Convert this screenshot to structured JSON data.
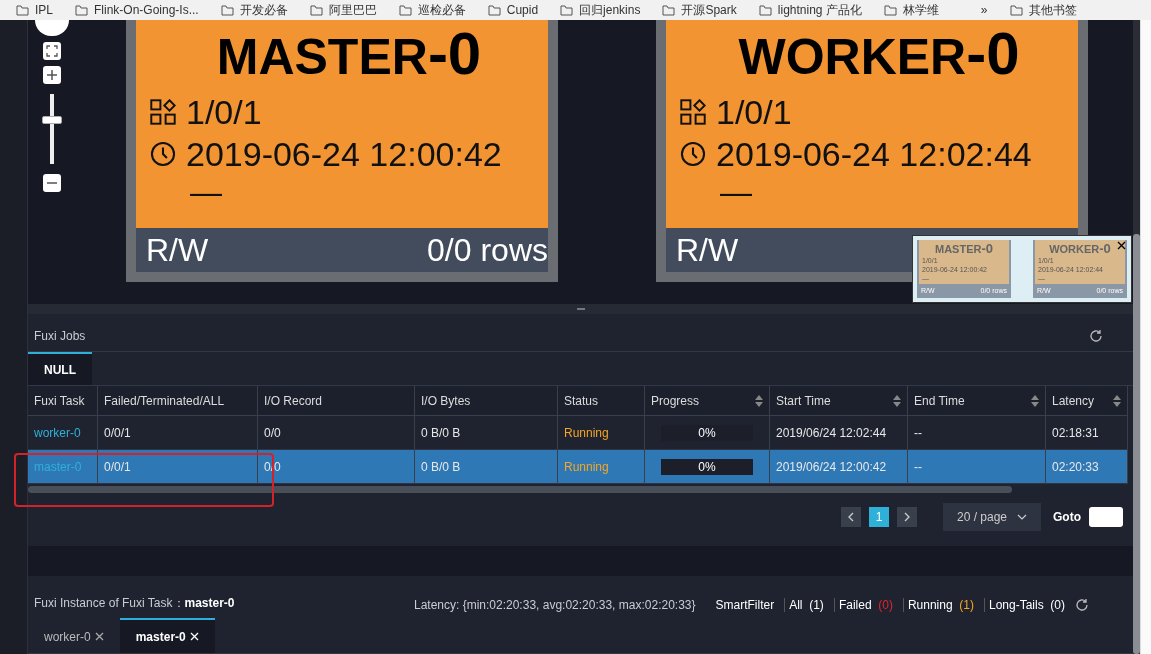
{
  "bookmarks": [
    {
      "label": "IPL"
    },
    {
      "label": "Flink-On-Going-Is..."
    },
    {
      "label": "开发必备"
    },
    {
      "label": "阿里巴巴"
    },
    {
      "label": "巡检必备"
    },
    {
      "label": "Cupid"
    },
    {
      "label": "回归jenkins"
    },
    {
      "label": "开源Spark"
    },
    {
      "label": "lightning 产品化"
    },
    {
      "label": "林学维"
    }
  ],
  "bookmarks_more": "»",
  "other_bookmarks": "其他书签",
  "zoom": {
    "level": 0.63
  },
  "nodes": [
    {
      "title": "MASTER",
      "suffix": "-0",
      "count": "1/0/1",
      "time": "2019-06-24 12:00:42",
      "dash": "—",
      "rw": "R/W",
      "rows": "0/0 rows"
    },
    {
      "title": "WORKER",
      "suffix": "-0",
      "count": "1/0/1",
      "time": "2019-06-24 12:02:44",
      "dash": "—",
      "rw": "R/W"
    }
  ],
  "minimap": [
    {
      "title": "MASTER",
      "suffix": "-0",
      "count": "1/0/1",
      "time": "2019-06-24 12:00:42",
      "dash": "—",
      "rw": "R/W",
      "rows": "0/0 rows"
    },
    {
      "title": "WORKER",
      "suffix": "-0",
      "count": "1/0/1",
      "time": "2019-06-24 12:02:44",
      "dash": "—",
      "rw": "R/W",
      "rows": "0/0 rows"
    }
  ],
  "jobs": {
    "title": "Fuxi Jobs",
    "tabs": [
      {
        "label": "NULL",
        "selected": true
      }
    ],
    "columns": [
      {
        "label": "Fuxi Task",
        "sortable": false
      },
      {
        "label": "Failed/Terminated/ALL",
        "sortable": false
      },
      {
        "label": "I/O Record",
        "sortable": false
      },
      {
        "label": "I/O Bytes",
        "sortable": false
      },
      {
        "label": "Status",
        "sortable": false
      },
      {
        "label": "Progress",
        "sortable": true
      },
      {
        "label": "Start Time",
        "sortable": true
      },
      {
        "label": "End Time",
        "sortable": true
      },
      {
        "label": "Latency",
        "sortable": true
      }
    ],
    "rows": [
      {
        "task": "worker-0",
        "failed": "0/0/1",
        "io_record": "0/0",
        "io_bytes": "0 B/0 B",
        "status": "Running",
        "level": 0,
        "progress": "0%",
        "start": "2019/06/24 12:02:44",
        "end": "--",
        "latency": "02:18:31",
        "selected": false
      },
      {
        "task": "master-0",
        "failed": "0/0/1",
        "io_record": "0/0",
        "io_bytes": "0 B/0 B",
        "status": "Running",
        "level": 0,
        "progress": "0%",
        "start": "2019/06/24 12:00:42",
        "end": "--",
        "latency": "02:20:33",
        "selected": true
      }
    ],
    "pages": [
      {
        "label": "1",
        "selected": true
      }
    ],
    "page_size": "20 / page",
    "goto": "Goto"
  },
  "instance": {
    "label": "Fuxi Instance of Fuxi Task：",
    "task": "master-0",
    "latency": "Latency: {min:02:20:33, avg:02:20:33, max:02:20:33}",
    "smart_filter": "SmartFilter",
    "filters": [
      {
        "label": "All",
        "count": "(1)",
        "color": "#ffffff"
      },
      {
        "label": "Failed",
        "count": "(0)",
        "color": "#e0242c"
      },
      {
        "label": "Running",
        "count": "(1)",
        "color": "#f5a623"
      },
      {
        "label": "Long-Tails",
        "count": "(0)",
        "color": "#ffffff"
      }
    ],
    "tabs": [
      {
        "label": "worker-0",
        "selected": false
      },
      {
        "label": "master-0",
        "selected": true
      }
    ]
  }
}
